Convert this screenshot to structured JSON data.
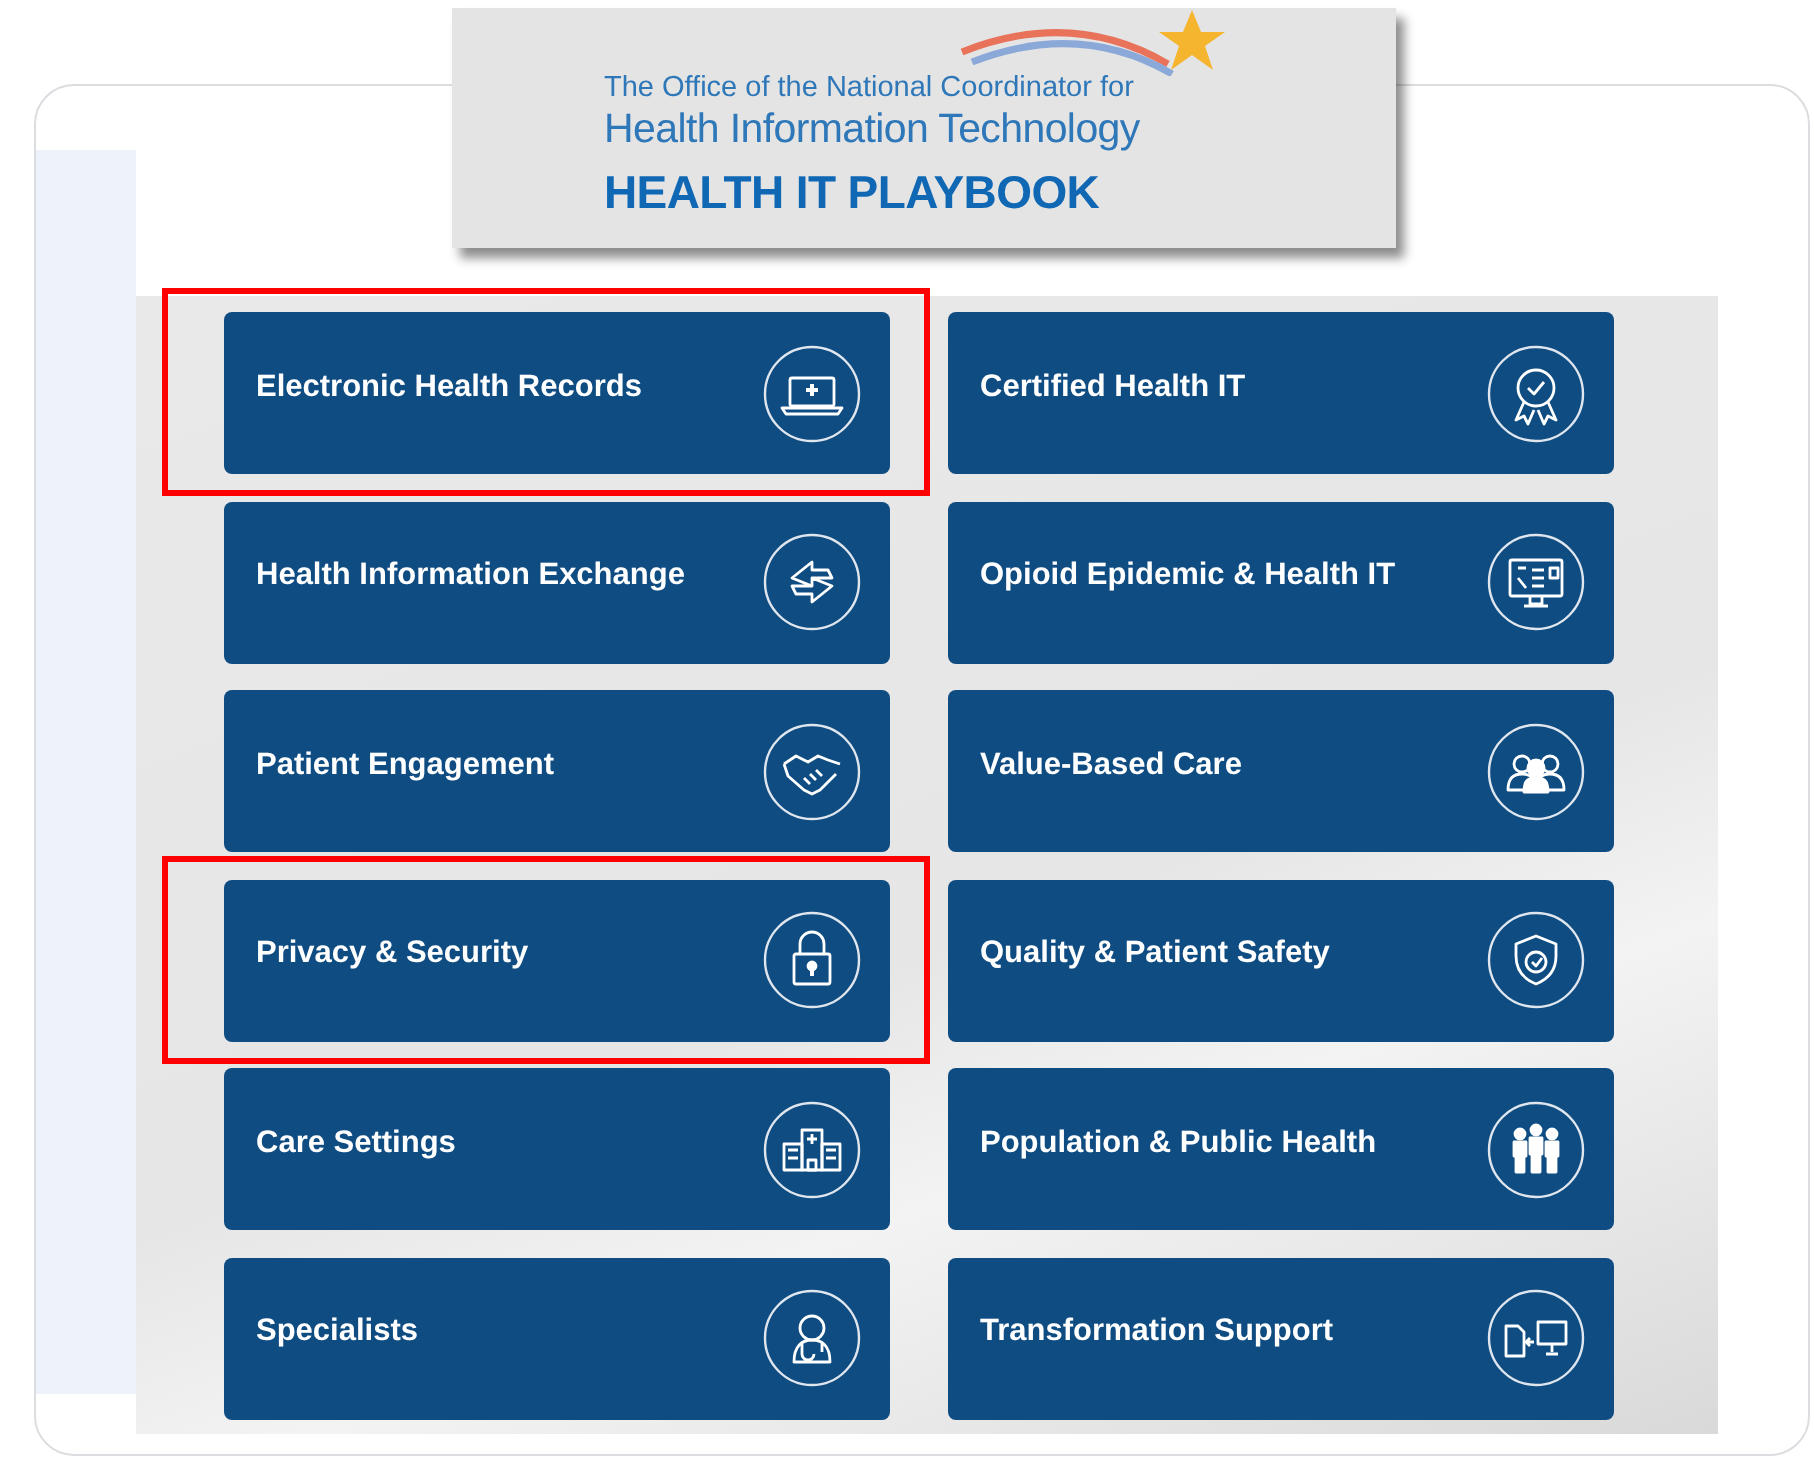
{
  "logo": {
    "org_line": "The Office of the National Coordinator for",
    "org_name": "Health Information Technology",
    "title": "HEALTH IT PLAYBOOK"
  },
  "tiles": [
    {
      "label": "Electronic Health Records",
      "highlighted": true
    },
    {
      "label": "Certified Health IT",
      "highlighted": false
    },
    {
      "label": "Health Information Exchange",
      "highlighted": false
    },
    {
      "label": "Opioid Epidemic & Health IT",
      "highlighted": false
    },
    {
      "label": "Patient Engagement",
      "highlighted": false
    },
    {
      "label": "Value-Based Care",
      "highlighted": false
    },
    {
      "label": "Privacy & Security",
      "highlighted": true
    },
    {
      "label": "Quality & Patient Safety",
      "highlighted": false
    },
    {
      "label": "Care Settings",
      "highlighted": false
    },
    {
      "label": "Population & Public Health",
      "highlighted": false
    },
    {
      "label": "Specialists",
      "highlighted": false
    },
    {
      "label": "Transformation Support",
      "highlighted": false
    }
  ]
}
